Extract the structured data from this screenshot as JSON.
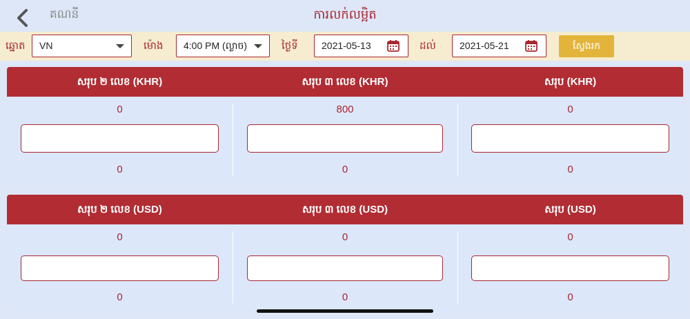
{
  "header": {
    "back_label": "គណនី",
    "title": "ការលក់លម្អិត"
  },
  "filters": {
    "station_label": "ឆ្នោត",
    "station_value": "VN",
    "time_label": "ម៉ោង",
    "time_value": "4:00 PM (ល្ងាច)",
    "date_label": "ថ្ងៃទី",
    "date_from": "2021-05-13",
    "to_label": "ដល់",
    "date_to": "2021-05-21",
    "search_label": "ស្វែងរក"
  },
  "khr": {
    "columns": [
      {
        "title": "សរុប ២ លេខ (KHR)",
        "top": "0",
        "bottom": "0"
      },
      {
        "title": "សរុប ៣ លេខ (KHR)",
        "top": "800",
        "bottom": "0"
      },
      {
        "title": "សរុប (KHR)",
        "top": "0",
        "bottom": "0"
      }
    ]
  },
  "usd": {
    "columns": [
      {
        "title": "សរុប ២ លេខ (USD)",
        "top": "0",
        "bottom": "0"
      },
      {
        "title": "សរុប ៣ លេខ (USD)",
        "top": "0",
        "bottom": "0"
      },
      {
        "title": "សរុប (USD)",
        "top": "0",
        "bottom": "0"
      }
    ]
  },
  "colors": {
    "accent": "#b12d33",
    "background": "#dde7f8",
    "filter_bar": "#f6ecd0",
    "search_button": "#e3b43a"
  },
  "icons": [
    "chevron-left-icon",
    "chevron-down-icon",
    "calendar-icon"
  ]
}
